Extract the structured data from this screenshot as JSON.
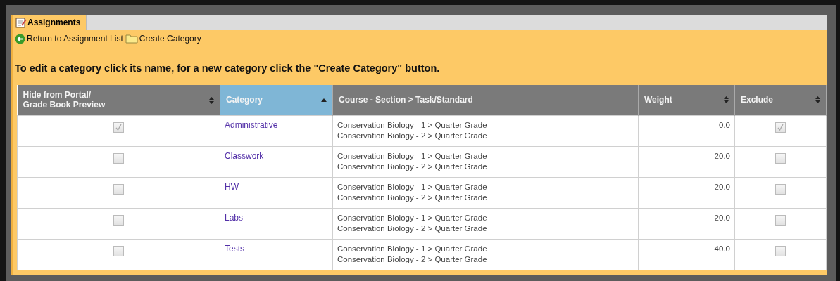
{
  "tab": {
    "label": "Assignments",
    "selected": true
  },
  "toolbar": [
    {
      "kind": "back",
      "label": "Return to Assignment List"
    },
    {
      "kind": "folder",
      "label": "Create Category"
    }
  ],
  "instruction": "To edit a category click its name, for a new category click the \"Create Category\" button.",
  "columns": [
    {
      "label": "Hide from Portal/\nGrade Book Preview",
      "sortable": true,
      "selected": false
    },
    {
      "label": "Category",
      "sortable": true,
      "selected": true
    },
    {
      "label": "Course - Section > Task/Standard",
      "sortable": false,
      "selected": false
    },
    {
      "label": "Weight",
      "sortable": true,
      "selected": false
    },
    {
      "label": "Exclude",
      "sortable": true,
      "selected": false
    }
  ],
  "rows": [
    {
      "hide": true,
      "category": "Administrative",
      "tasks": [
        "Conservation Biology - 1 > Quarter Grade",
        "Conservation Biology - 2 > Quarter Grade"
      ],
      "weight": "0.0",
      "exclude": true
    },
    {
      "hide": false,
      "category": "Classwork",
      "tasks": [
        "Conservation Biology - 1 > Quarter Grade",
        "Conservation Biology - 2 > Quarter Grade"
      ],
      "weight": "20.0",
      "exclude": false
    },
    {
      "hide": false,
      "category": "HW",
      "tasks": [
        "Conservation Biology - 1 > Quarter Grade",
        "Conservation Biology - 2 > Quarter Grade"
      ],
      "weight": "20.0",
      "exclude": false
    },
    {
      "hide": false,
      "category": "Labs",
      "tasks": [
        "Conservation Biology - 1 > Quarter Grade",
        "Conservation Biology - 2 > Quarter Grade"
      ],
      "weight": "20.0",
      "exclude": false
    },
    {
      "hide": false,
      "category": "Tests",
      "tasks": [
        "Conservation Biology - 1 > Quarter Grade",
        "Conservation Biology - 2 > Quarter Grade"
      ],
      "weight": "40.0",
      "exclude": false
    }
  ]
}
